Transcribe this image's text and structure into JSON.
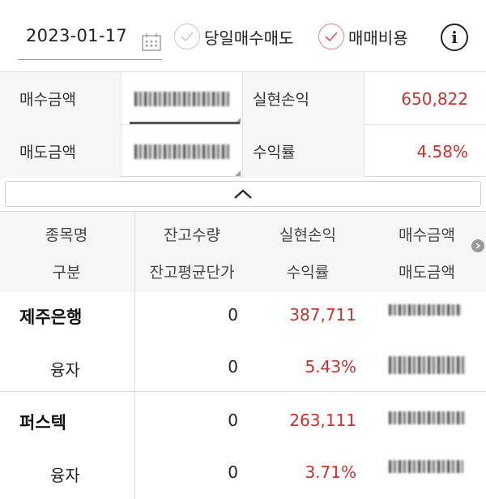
{
  "filters": {
    "date": "2023-01-17",
    "same_day_label": "당일매수매도",
    "trade_cost_label": "매매비용",
    "trade_cost_checked": true,
    "same_day_checked": false
  },
  "summary": {
    "buy_amount_label": "매수금액",
    "sell_amount_label": "매도금액",
    "realized_pl_label": "실현손익",
    "return_label": "수익률",
    "realized_pl_value": "650,822",
    "return_value": "4.58%"
  },
  "table": {
    "headers_row1": [
      "종목명",
      "잔고수량",
      "실현손익",
      "매수금액"
    ],
    "headers_row2": [
      "구분",
      "잔고평균단가",
      "수익률",
      "매도금액"
    ],
    "rows": [
      {
        "name": "제주은행",
        "type": "융자",
        "qty": "0",
        "avg_price": "0",
        "pl": "387,711",
        "return": "5.43%"
      },
      {
        "name": "퍼스텍",
        "type": "융자",
        "qty": "0",
        "avg_price": "0",
        "pl": "263,111",
        "return": "3.71%"
      }
    ]
  },
  "colors": {
    "accent_red": "#c9312f"
  }
}
